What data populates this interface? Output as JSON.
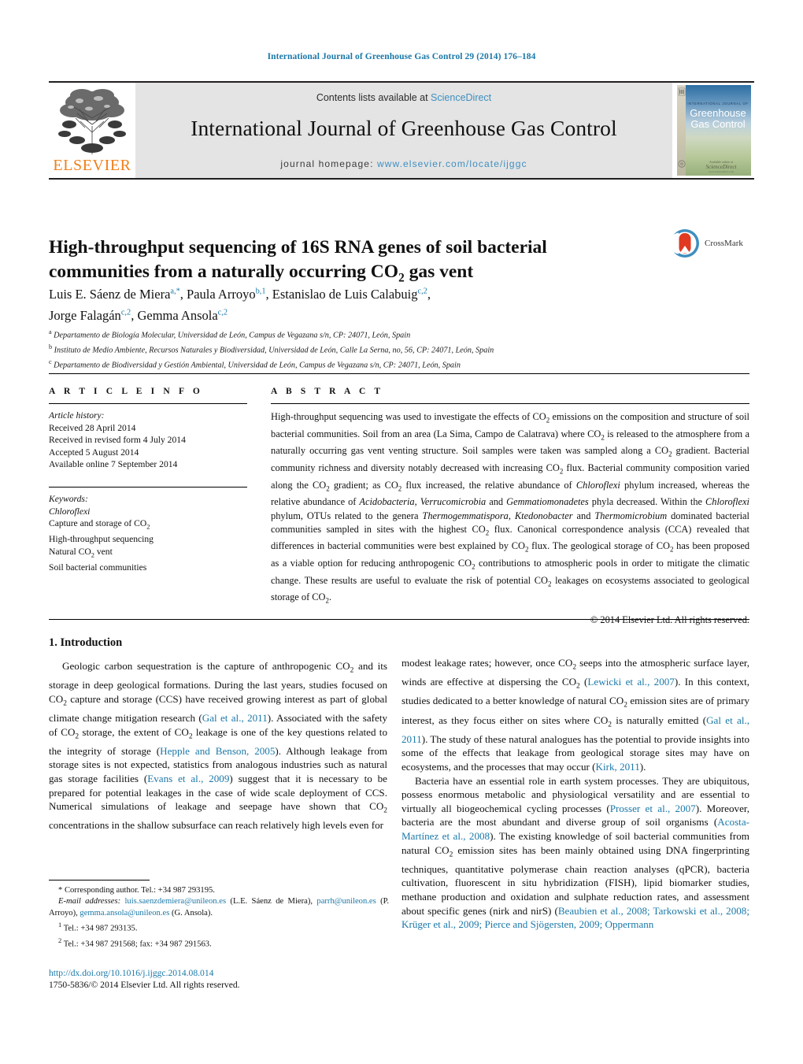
{
  "running_head": "International Journal of Greenhouse Gas Control 29 (2014) 176–184",
  "masthead": {
    "publisher": "ELSEVIER",
    "contents_prefix": "Contents lists available at ",
    "contents_link": "ScienceDirect",
    "journal_title": "International Journal of Greenhouse Gas Control",
    "homepage_prefix": "journal homepage: ",
    "homepage_url": "www.elsevier.com/locate/ijggc",
    "cover": {
      "kicker": "INTERNATIONAL JOURNAL OF",
      "line1": "Greenhouse",
      "line2": "Gas Control"
    }
  },
  "article": {
    "title_line1": "High-throughput sequencing of 16S RNA genes of soil bacterial",
    "title_line2_a": "communities from a naturally occurring CO",
    "title_line2_sub": "2",
    "title_line2_b": " gas vent",
    "crossmark_label": "CrossMark",
    "authors": [
      {
        "name": "Luis E. Sáenz de Miera",
        "marks": "a,*",
        "sep": ", "
      },
      {
        "name": "Paula Arroyo",
        "marks": "b,1",
        "sep": ", "
      },
      {
        "name": "Estanislao de Luis Calabuig",
        "marks": "c,2",
        "sep": ","
      },
      {
        "name": "Jorge Falagán",
        "marks": "c,2",
        "sep": ", "
      },
      {
        "name": "Gemma Ansola",
        "marks": "c,2",
        "sep": ""
      }
    ],
    "affiliations": [
      {
        "mark": "a",
        "text": "Departamento de Biología Molecular, Universidad de León, Campus de Vegazana s/n, CP: 24071, León, Spain"
      },
      {
        "mark": "b",
        "text": "Instituto de Medio Ambiente, Recursos Naturales y Biodiversidad, Universidad de León, Calle La Serna, no, 56, CP: 24071, León, Spain"
      },
      {
        "mark": "c",
        "text": "Departamento de Biodiversidad y Gestión Ambiental, Universidad de León, Campus de Vegazana s/n, CP: 24071, León, Spain"
      }
    ]
  },
  "article_info": {
    "heading": "A R T I C L E    I N F O",
    "history_label": "Article history:",
    "history": [
      "Received 28 April 2014",
      "Received in revised form 4 July 2014",
      "Accepted 5 August 2014",
      "Available online 7 September 2014"
    ],
    "keywords_label": "Keywords:",
    "keywords": [
      "Chloroflexi",
      "Capture and storage of CO2",
      "High-throughput sequencing",
      "Natural CO2 vent",
      "Soil bacterial communities"
    ]
  },
  "abstract": {
    "heading": "A B S T R A C T",
    "text": "High-throughput sequencing was used to investigate the effects of CO2 emissions on the composition and structure of soil bacterial communities. Soil from an area (La Sima, Campo de Calatrava) where CO2 is released to the atmosphere from a naturally occurring gas vent venting structure. Soil samples were taken was sampled along a CO2 gradient. Bacterial community richness and diversity notably decreased with increasing CO2 flux. Bacterial community composition varied along the CO2 gradient; as CO2 flux increased, the relative abundance of Chloroflexi phylum increased, whereas the relative abundance of Acidobacteria, Verrucomicrobia and Gemmatiomonadetes phyla decreased. Within the Chloroflexi phylum, OTUs related to the genera Thermogemmatispora, Ktedonobacter and Thermomicrobium dominated bacterial communities sampled in sites with the highest CO2 flux. Canonical correspondence analysis (CCA) revealed that differences in bacterial communities were best explained by CO2 flux. The geological storage of CO2 has been proposed as a viable option for reducing anthropogenic CO2 contributions to atmospheric pools in order to mitigate the climatic change. These results are useful to evaluate the risk of potential CO2 leakages on ecosystems associated to geological storage of CO2.",
    "copyright": "© 2014 Elsevier Ltd. All rights reserved."
  },
  "body": {
    "section1_heading": "1.  Introduction",
    "left_paragraph": "Geologic carbon sequestration is the capture of anthropogenic CO2 and its storage in deep geological formations. During the last years, studies focused on CO2 capture and storage (CCS) have received growing interest as part of global climate change mitigation research (Gal et al., 2011). Associated with the safety of CO2 storage, the extent of CO2 leakage is one of the key questions related to the integrity of storage (Hepple and Benson, 2005). Although leakage from storage sites is not expected, statistics from analogous industries such as natural gas storage facilities (Evans et al., 2009) suggest that it is necessary to be prepared for potential leakages in the case of wide scale deployment of CCS. Numerical simulations of leakage and seepage have shown that CO2 concentrations in the shallow subsurface can reach relatively high levels even for",
    "right_paragraph_1": "modest leakage rates; however, once CO2 seeps into the atmospheric surface layer, winds are effective at dispersing the CO2 (Lewicki et al., 2007). In this context, studies dedicated to a better knowledge of natural CO2 emission sites are of primary interest, as they focus either on sites where CO2 is naturally emitted (Gal et al., 2011). The study of these natural analogues has the potential to provide insights into some of the effects that leakage from geological storage sites may have on ecosystems, and the processes that may occur (Kirk, 2011).",
    "right_paragraph_2": "Bacteria have an essential role in earth system processes. They are ubiquitous, possess enormous metabolic and physiological versatility and are essential to virtually all biogeochemical cycling processes (Prosser et al., 2007). Moreover, bacteria are the most abundant and diverse group of soil organisms (Acosta-Martínez et al., 2008). The existing knowledge of soil bacterial communities from natural CO2 emission sites has been mainly obtained using DNA fingerprinting techniques, quantitative polymerase chain reaction analyses (qPCR), bacteria cultivation, fluorescent in situ hybridization (FISH), lipid biomarker studies, methane production and oxidation and sulphate reduction rates, and assessment about specific genes (nirk and nirS) (Beaubien et al., 2008; Tarkowski et al., 2008; Krüger et al., 2009; Pierce and Sjögersten, 2009; Oppermann"
  },
  "footnotes": {
    "corresponding": "* Corresponding author. Tel.: +34 987 293195.",
    "email_label": "E-mail addresses:",
    "emails": [
      {
        "address": "luis.saenzdemiera@unileon.es",
        "owner": " (L.E. Sáenz de Miera),"
      },
      {
        "address": "parrh@unileon.es",
        "owner": " (P. Arroyo), "
      },
      {
        "address": "gemma.ansola@unileon.es",
        "owner": " (G. Ansola)."
      }
    ],
    "tel1": "Tel.: +34 987 293135.",
    "tel2": "Tel.: +34 987 291568; fax: +34 987 291563.",
    "tel1_mark": "1",
    "tel2_mark": "2"
  },
  "doi_block": {
    "doi": "http://dx.doi.org/10.1016/j.ijggc.2014.08.014",
    "issn": "1750-5836/© 2014 Elsevier Ltd. All rights reserved."
  },
  "colors": {
    "link": "#1b78a8",
    "elsevier_orange": "#f07f1a",
    "masthead_grey": "#e4e4e4",
    "sciencedirect": "#3e8fc1"
  }
}
